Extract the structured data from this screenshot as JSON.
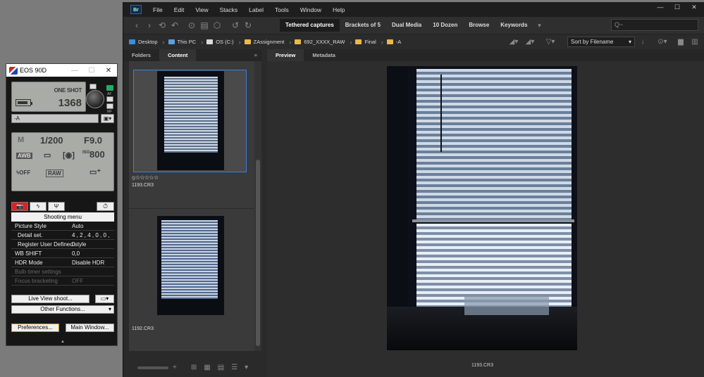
{
  "eos": {
    "title": "EOS 90D",
    "close": "✕",
    "minimize": "—",
    "maximize": "☐",
    "af_mode": "ONE SHOT",
    "shots_remaining": "1368",
    "picture_style_field": "-A",
    "shutter": "1/200",
    "aperture": "F9.0",
    "awb": "AWB",
    "iso_label": "ISO",
    "iso": "800",
    "quality": "RAW",
    "af_label": "AF",
    "mf_label": "MF",
    "tabs": [
      "📷",
      "ϟ",
      "Ψ"
    ],
    "menu_title": "Shooting menu",
    "menu_rows": [
      {
        "k": "Picture Style",
        "v": "Auto"
      },
      {
        "k": "Detail set.",
        "v": "4 , 2 , 4 , 0 , 0 , 0"
      },
      {
        "k": "Register User Defined style",
        "v": ""
      },
      {
        "k": "WB SHIFT",
        "v": "0,0"
      },
      {
        "k": "HDR Mode",
        "v": "Disable HDR"
      },
      {
        "k": "Bulb timer settings",
        "v": ""
      },
      {
        "k": "Focus bracketing",
        "v": "OFF"
      }
    ],
    "live_view_button": "Live View shoot...",
    "other_functions_button": "Other Functions...",
    "preferences_button": "Preferences...",
    "main_window_button": "Main Window..."
  },
  "bridge": {
    "menu": [
      "File",
      "Edit",
      "View",
      "Stacks",
      "Label",
      "Tools",
      "Window",
      "Help"
    ],
    "workspaces": [
      "Tethered captures",
      "Brackets of 5",
      "Dual Media",
      "10 Dozen",
      "Browse",
      "Keywords"
    ],
    "search_placeholder": "Q~",
    "breadcrumbs": [
      "Desktop",
      "This PC",
      "OS (C:)",
      "ZAssignment",
      "692_XXXX_RAW",
      "Final",
      "-A"
    ],
    "sort_label": "Sort by Filename",
    "left_tabs": [
      "Folders",
      "Content"
    ],
    "right_tabs": [
      "Preview",
      "Metadata"
    ],
    "thumbnails": [
      {
        "name": "1193.CR3",
        "rating": "⦸☆☆☆☆☆"
      },
      {
        "name": "1192.CR3"
      }
    ],
    "preview_caption": "1193.CR3"
  },
  "colors": {
    "selection": "#3d7fdb",
    "active_tab_red": "#d8232a",
    "folder": "#e9b949"
  }
}
